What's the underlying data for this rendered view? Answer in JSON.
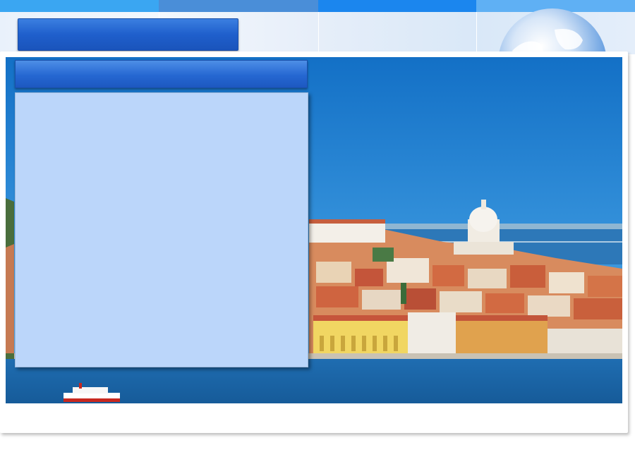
{
  "header": {
    "title": "",
    "subtitle": ""
  },
  "content": {
    "text": ""
  },
  "colors": {
    "accent": "#1f5fcc",
    "panel": "#bbd6fa",
    "sky": "#1c7fd2",
    "sea": "#1766ae"
  },
  "decor": {
    "globe_icon": "globe-icon",
    "photo": "city-harbor-photo"
  }
}
